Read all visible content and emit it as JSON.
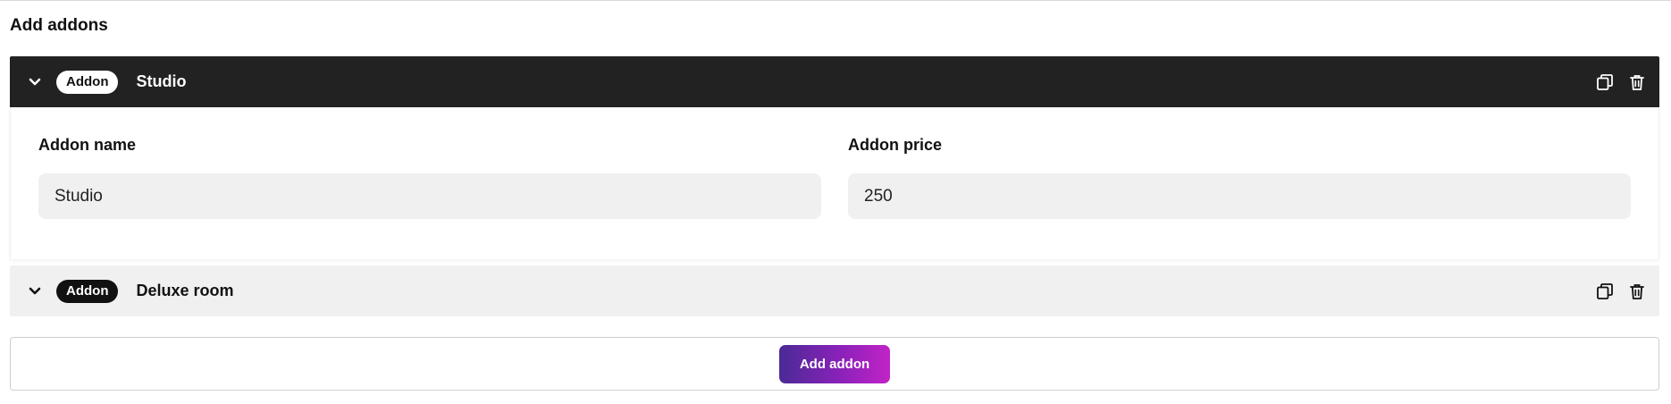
{
  "section": {
    "title": "Add addons"
  },
  "addons": [
    {
      "badge": "Addon",
      "title": "Studio",
      "expanded": true,
      "icons": {
        "toggle": "chevron-down-icon",
        "duplicate": "duplicate-icon",
        "delete": "trash-icon"
      },
      "fields": {
        "name_label": "Addon name",
        "name_value": "Studio",
        "price_label": "Addon price",
        "price_value": "250"
      }
    },
    {
      "badge": "Addon",
      "title": "Deluxe room",
      "expanded": false,
      "icons": {
        "toggle": "chevron-down-icon",
        "duplicate": "duplicate-icon",
        "delete": "trash-icon"
      }
    }
  ],
  "actions": {
    "add_label": "Add addon"
  },
  "colors": {
    "header_dark": "#222222",
    "header_light": "#f0f0f0",
    "input_bg": "#f0f0f0",
    "gradient_start": "#4a2a95",
    "gradient_end": "#c123c6"
  }
}
